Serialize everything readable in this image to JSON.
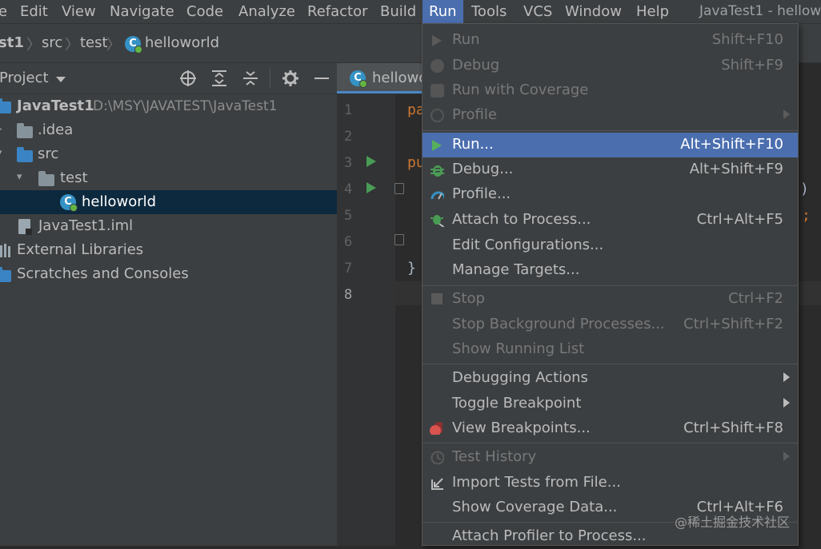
{
  "menubar": {
    "items": [
      "e",
      "Edit",
      "View",
      "Navigate",
      "Code",
      "Analyze",
      "Refactor",
      "Build",
      "Run",
      "Tools",
      "VCS",
      "Window",
      "Help"
    ],
    "window_title": "JavaTest1 - hellow"
  },
  "breadcrumb": [
    "st1",
    "src",
    "test",
    "helloworld"
  ],
  "project_panel": {
    "title": "Project",
    "icons": [
      "locate-icon",
      "expand-all-icon",
      "collapse-all-icon",
      "gear-icon",
      "minimize-icon"
    ],
    "tree": [
      {
        "label": "JavaTest1",
        "path": "D:\\MSY\\JAVATEST\\JavaTest1"
      },
      {
        "label": ".idea"
      },
      {
        "label": "src"
      },
      {
        "label": "test"
      },
      {
        "label": "helloworld"
      },
      {
        "label": "JavaTest1.iml"
      },
      {
        "label": "External Libraries"
      },
      {
        "label": "Scratches and Consoles"
      }
    ]
  },
  "editor": {
    "tab_label": "hellowo",
    "line_numbers": [
      "1",
      "2",
      "3",
      "4",
      "5",
      "6",
      "7",
      "8"
    ],
    "code_fragments": [
      "pa",
      "pu",
      "}",
      ")",
      ";"
    ]
  },
  "run_menu": {
    "items": [
      {
        "label": "Run",
        "shortcut": "Shift+F10",
        "disabled": true
      },
      {
        "label": "Debug",
        "shortcut": "Shift+F9",
        "disabled": true
      },
      {
        "label": "Run with Coverage",
        "shortcut": "",
        "disabled": true
      },
      {
        "label": "Profile",
        "shortcut": "",
        "disabled": true,
        "submenu": true
      },
      {
        "label": "Run...",
        "shortcut": "Alt+Shift+F10",
        "highlighted": true
      },
      {
        "label": "Debug...",
        "shortcut": "Alt+Shift+F9"
      },
      {
        "label": "Profile...",
        "shortcut": ""
      },
      {
        "label": "Attach to Process...",
        "shortcut": "Ctrl+Alt+F5"
      },
      {
        "label": "Edit Configurations...",
        "shortcut": ""
      },
      {
        "label": "Manage Targets...",
        "shortcut": ""
      },
      {
        "label": "Stop",
        "shortcut": "Ctrl+F2",
        "disabled": true
      },
      {
        "label": "Stop Background Processes...",
        "shortcut": "Ctrl+Shift+F2",
        "disabled": true
      },
      {
        "label": "Show Running List",
        "shortcut": "",
        "disabled": true
      },
      {
        "label": "Debugging Actions",
        "shortcut": "",
        "submenu": true
      },
      {
        "label": "Toggle Breakpoint",
        "shortcut": "",
        "submenu": true
      },
      {
        "label": "View Breakpoints...",
        "shortcut": "Ctrl+Shift+F8"
      },
      {
        "label": "Test History",
        "shortcut": "",
        "disabled": true,
        "submenu": true
      },
      {
        "label": "Import Tests from File...",
        "shortcut": ""
      },
      {
        "label": "Show Coverage Data...",
        "shortcut": "Ctrl+Alt+F6"
      },
      {
        "label": "Attach Profiler to Process...",
        "shortcut": ""
      }
    ]
  },
  "watermark": "@稀土掘金技术社区",
  "colors": {
    "accent": "#4b6eaf",
    "run_green": "#499c54",
    "keyword_orange": "#cc7832",
    "selection": "#0d293e"
  }
}
